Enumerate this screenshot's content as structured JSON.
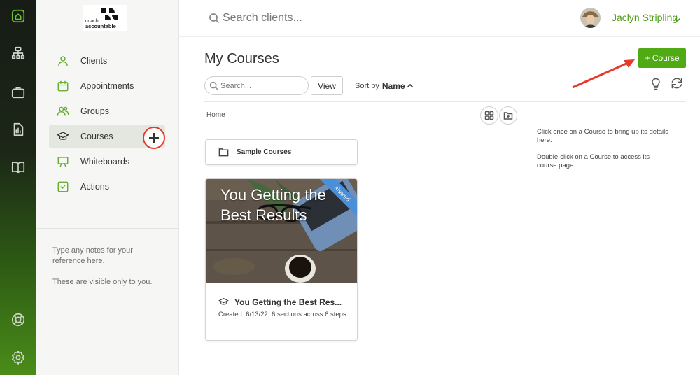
{
  "rail": {
    "icons": [
      "home-icon",
      "org-chart-icon",
      "briefcase-icon",
      "report-icon",
      "book-icon",
      "lifebuoy-icon",
      "gear-icon"
    ]
  },
  "brand": {
    "line1": "coach",
    "line2": "accountable"
  },
  "nav": {
    "items": [
      {
        "label": "Clients",
        "icon": "person-icon"
      },
      {
        "label": "Appointments",
        "icon": "calendar-icon"
      },
      {
        "label": "Groups",
        "icon": "group-icon"
      },
      {
        "label": "Courses",
        "icon": "graduation-cap-icon",
        "active": true
      },
      {
        "label": "Whiteboards",
        "icon": "whiteboard-icon"
      },
      {
        "label": "Actions",
        "icon": "checkbox-icon"
      }
    ],
    "add_course_icon": "plus-icon"
  },
  "notes": {
    "line1": "Type any notes for your reference here.",
    "line2": "These are visible only to you."
  },
  "topbar": {
    "search_placeholder": "Search clients...",
    "user_name": "Jaclyn Stripling"
  },
  "page": {
    "title": "My Courses",
    "add_course_label": "+ Course",
    "search_placeholder": "Search...",
    "view_label": "View",
    "sort_prefix": "Sort by",
    "sort_field": "Name",
    "breadcrumb": "Home"
  },
  "folders": [
    {
      "name": "Sample Courses"
    }
  ],
  "courses": [
    {
      "image_title": "You Getting the Best Results",
      "badge": "shared",
      "title": "You Getting the Best Res...",
      "meta": "Created: 6/13/22, 6 sections across 6 steps"
    }
  ],
  "info": {
    "line1": "Click once on a Course to bring up its details here.",
    "line2": "Double-click on a Course to access its course page."
  },
  "colors": {
    "accent": "#4faa14",
    "nav_icon": "#5aaa22",
    "annotation": "#e53a2a",
    "badge": "#4a8fd9"
  }
}
